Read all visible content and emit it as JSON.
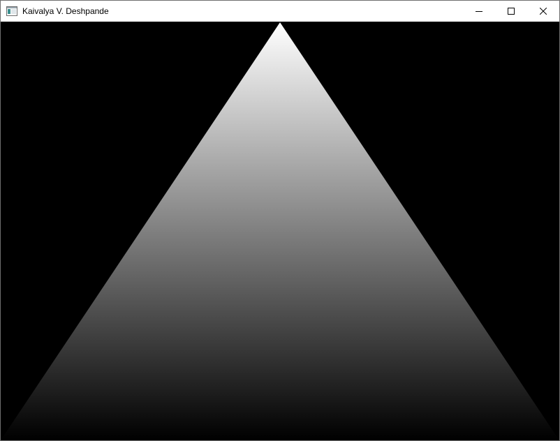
{
  "window": {
    "title": "Kaivalya V. Deshpande",
    "app_icon": "window-app-icon",
    "buttons": {
      "minimize": "minimize-icon",
      "maximize": "maximize-icon",
      "close": "close-icon"
    }
  },
  "canvas": {
    "background": "#000000",
    "shape": "triangle",
    "gradient": {
      "top_color": "#ffffff",
      "bottom_color": "#000000",
      "direction": "vertical"
    }
  }
}
